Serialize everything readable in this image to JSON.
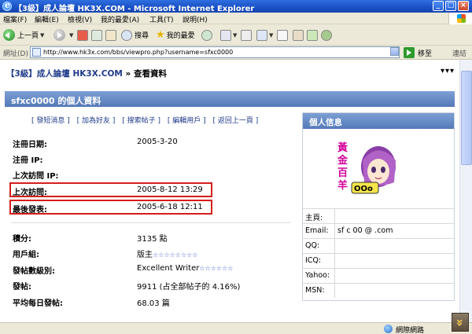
{
  "window": {
    "title": "【3級】成人論壇 HK3X.COM - Microsoft Internet Explorer",
    "controls": {
      "minimize": "_",
      "maximize": "□",
      "close": "×"
    }
  },
  "menu": [
    "檔案(F)",
    "編輯(E)",
    "檢視(V)",
    "我的最愛(A)",
    "工具(T)",
    "說明(H)"
  ],
  "toolbar": {
    "back": "上一頁",
    "search": "搜尋",
    "favorites": "我的最愛"
  },
  "address": {
    "label": "網址(D)",
    "url": "http://www.hk3x.com/bbs/viewpro.php?username=sfxc0000",
    "go": "移至",
    "links": "連結"
  },
  "page": {
    "breadcrumb": {
      "forum": "【3級】成人論壇 HK3X.COM",
      "sep": " » ",
      "current": "查看資料"
    },
    "more": "▾▾▾",
    "header": "sfxc0000 的個人資料",
    "actions": [
      "[ 發短消息 ]",
      "[ 加為好友 ]",
      "[ 搜索帖子 ]",
      "[ 編輯用戶 ]",
      "[ 返回上一頁 ]"
    ],
    "profile_top": [
      {
        "label": "注冊日期:",
        "value": "2005-3-20"
      },
      {
        "label": "注冊 IP:",
        "value": ""
      },
      {
        "label": "上次訪問 IP:",
        "value": ""
      },
      {
        "label": "上次訪問:",
        "value": "2005-8-12 13:29"
      },
      {
        "label": "最後發表:",
        "value": "2005-6-18 12:11"
      }
    ],
    "profile_bottom": {
      "points_label": "積分:",
      "points_value": "3135 點",
      "group_label": "用戶組:",
      "group_value": "版主",
      "group_stars": "☆☆☆☆☆☆☆☆",
      "rank_label": "發帖數級別:",
      "rank_value": "Excellent Writer",
      "rank_stars": "☆☆☆☆☆☆",
      "posts_label": "發帖:",
      "posts_value": "9911 (占全部帖子的 4.16%)",
      "avg_label": "平均每日發帖:",
      "avg_value": "68.03 篇"
    },
    "side": {
      "title": "個人信息",
      "avatar_text": [
        "黃",
        "金",
        "百",
        "羊"
      ],
      "avatar_badge": "OOo",
      "rows": [
        {
          "label": "主頁:",
          "value": ""
        },
        {
          "label": "Email:",
          "value": "sf c 00 @          .com"
        },
        {
          "label": "QQ:",
          "value": ""
        },
        {
          "label": "ICQ:",
          "value": ""
        },
        {
          "label": "Yahoo:",
          "value": ""
        },
        {
          "label": "MSN:",
          "value": ""
        }
      ]
    }
  },
  "status": {
    "zone": "網際網路"
  },
  "colors": {
    "header_blue": "#5479b8",
    "highlight_red": "#d41c1c",
    "link_blue": "#1f3a8a"
  }
}
